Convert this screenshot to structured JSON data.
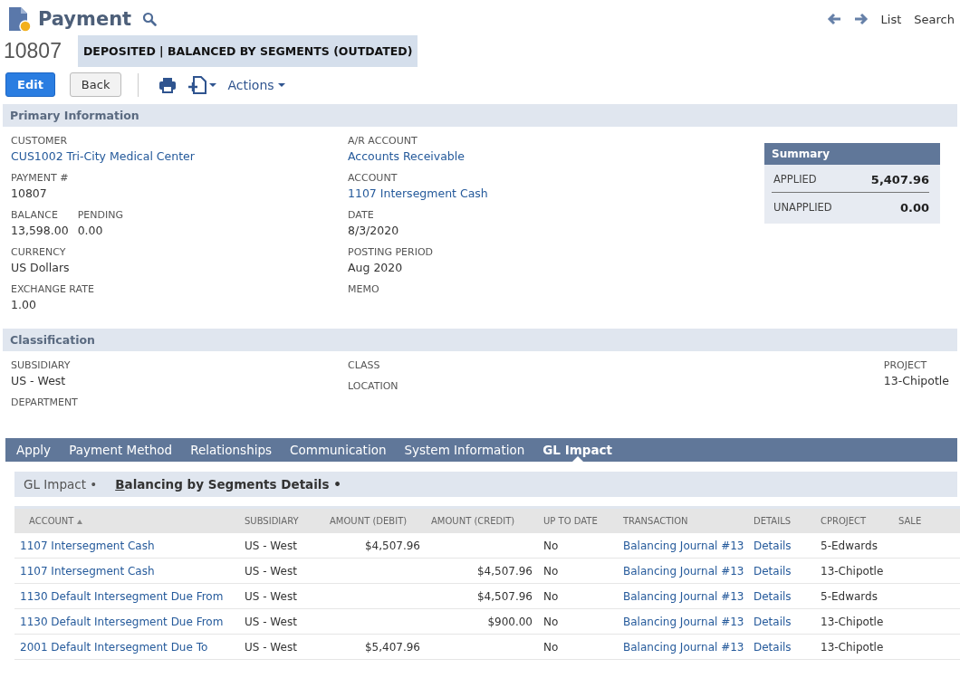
{
  "header": {
    "title": "Payment",
    "nav": [
      "List",
      "Search"
    ],
    "record_number": "10807",
    "status": "DEPOSITED | BALANCED BY SEGMENTS (OUTDATED)"
  },
  "toolbar": {
    "buttons": [
      {
        "label": "Edit",
        "kind": "primary"
      },
      {
        "label": "Back",
        "kind": "secondary"
      }
    ],
    "actions": "Actions"
  },
  "sections": [
    {
      "title": "Primary Information",
      "columns": [
        [
          {
            "fields": [
              {
                "label": "CUSTOMER",
                "value": "CUS1002 Tri-City Medical Center",
                "link": true
              }
            ]
          },
          {
            "fields": [
              {
                "label": "PAYMENT #",
                "value": "10807",
                "link": false
              }
            ]
          },
          {
            "fields": [
              {
                "label": "BALANCE",
                "value": "13,598.00",
                "link": false
              },
              {
                "label": "PENDING",
                "value": "0.00",
                "link": false
              }
            ]
          },
          {
            "fields": [
              {
                "label": "CURRENCY",
                "value": "US Dollars",
                "link": false
              }
            ]
          },
          {
            "fields": [
              {
                "label": "EXCHANGE RATE",
                "value": "1.00",
                "link": false
              }
            ]
          }
        ],
        [
          {
            "fields": [
              {
                "label": "A/R ACCOUNT",
                "value": "Accounts Receivable",
                "link": true
              }
            ]
          },
          {
            "fields": [
              {
                "label": "ACCOUNT",
                "value": "1107 Intersegment Cash",
                "link": true
              }
            ]
          },
          {
            "fields": [
              {
                "label": "DATE",
                "value": "8/3/2020",
                "link": false
              }
            ]
          },
          {
            "fields": [
              {
                "label": "POSTING PERIOD",
                "value": "Aug 2020",
                "link": false
              }
            ]
          },
          {
            "fields": [
              {
                "label": "MEMO"
              }
            ]
          }
        ]
      ],
      "summary": {
        "title": "Summary",
        "lines": [
          {
            "label": "APPLIED",
            "value": "5,407.96"
          },
          {
            "label": "UNAPPLIED",
            "value": "0.00"
          }
        ]
      }
    },
    {
      "title": "Classification",
      "columns": [
        [
          {
            "fields": [
              {
                "label": "SUBSIDIARY",
                "value": "US - West",
                "link": false
              }
            ]
          },
          {
            "fields": [
              {
                "label": "DEPARTMENT"
              }
            ]
          }
        ],
        [
          {
            "fields": [
              {
                "label": "CLASS"
              }
            ]
          },
          {
            "fields": [
              {
                "label": "LOCATION"
              }
            ]
          }
        ],
        [
          {
            "fields": [
              {
                "label": "PROJECT",
                "value": "13-Chipotle",
                "link": false
              }
            ]
          }
        ]
      ]
    }
  ],
  "tabs": [
    {
      "label": "Apply",
      "selected": false
    },
    {
      "label": "Payment Method",
      "selected": false
    },
    {
      "label": "Relationships",
      "selected": false
    },
    {
      "label": "Communication",
      "selected": false
    },
    {
      "label": "System Information",
      "selected": false
    },
    {
      "label": "GL Impact",
      "selected": true
    }
  ],
  "subtabs": [
    {
      "label": "GL Impact •",
      "selected": false
    },
    {
      "label": "Balancing by Segments Details •",
      "selected": true
    }
  ],
  "table": {
    "columns": [
      {
        "label": "ACCOUNT",
        "kind": "link",
        "sorted": true
      },
      {
        "label": "SUBSIDIARY",
        "kind": "text",
        "sorted": false
      },
      {
        "label": "AMOUNT (DEBIT)",
        "kind": "amount",
        "sorted": false
      },
      {
        "label": "AMOUNT (CREDIT)",
        "kind": "amount",
        "sorted": false
      },
      {
        "label": "UP TO DATE",
        "kind": "text",
        "sorted": false
      },
      {
        "label": "TRANSACTION",
        "kind": "link",
        "sorted": false
      },
      {
        "label": "DETAILS",
        "kind": "link",
        "sorted": false
      },
      {
        "label": "CPROJECT",
        "kind": "text",
        "sorted": false
      },
      {
        "label": "SALE",
        "kind": "text",
        "sorted": false
      }
    ],
    "rows": [
      [
        "1107 Intersegment Cash",
        "US - West",
        "$4,507.96",
        "",
        "No",
        "Balancing Journal #13",
        "Details",
        "5-Edwards",
        ""
      ],
      [
        "1107 Intersegment Cash",
        "US - West",
        "",
        "$4,507.96",
        "No",
        "Balancing Journal #13",
        "Details",
        "13-Chipotle",
        ""
      ],
      [
        "1130 Default Intersegment Due From",
        "US - West",
        "",
        "$4,507.96",
        "No",
        "Balancing Journal #13",
        "Details",
        "5-Edwards",
        ""
      ],
      [
        "1130 Default Intersegment Due From",
        "US - West",
        "",
        "$900.00",
        "No",
        "Balancing Journal #13",
        "Details",
        "13-Chipotle",
        ""
      ],
      [
        "2001 Default Intersegment Due To",
        "US - West",
        "$5,407.96",
        "",
        "No",
        "Balancing Journal #13",
        "Details",
        "13-Chipotle",
        ""
      ]
    ]
  }
}
